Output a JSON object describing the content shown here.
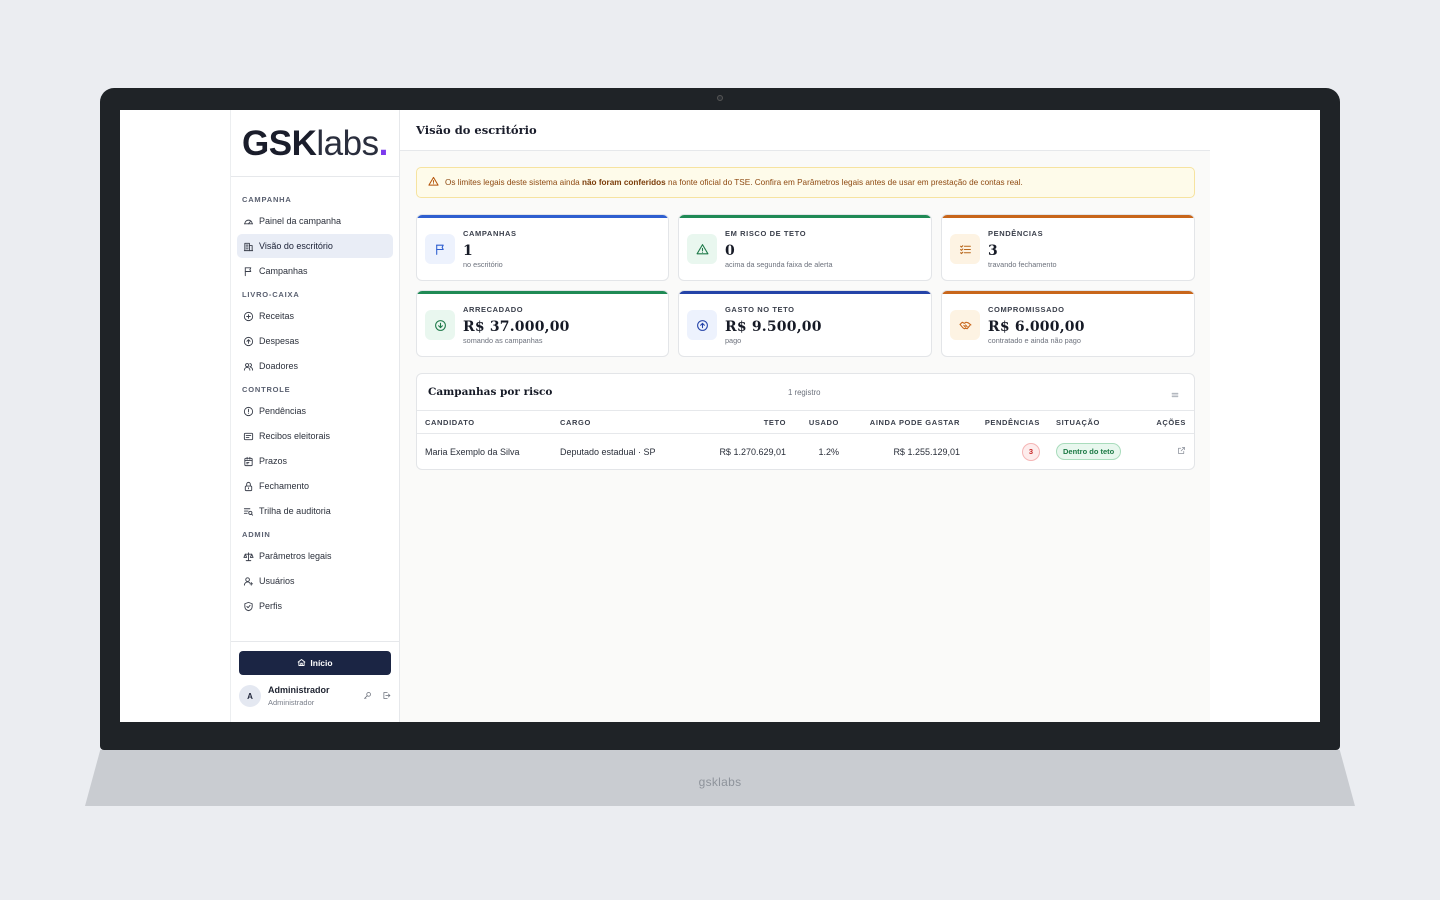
{
  "brand": {
    "part1": "GSK",
    "part2": "labs",
    "dot": ".",
    "device_label": "gsklabs"
  },
  "sidebar": {
    "sections": [
      {
        "title": "CAMPANHA",
        "items": [
          {
            "label": "Painel da campanha",
            "icon": "gauge-icon"
          },
          {
            "label": "Visão do escritório",
            "icon": "building-icon",
            "active": true
          },
          {
            "label": "Campanhas",
            "icon": "flag-icon"
          }
        ]
      },
      {
        "title": "LIVRO-CAIXA",
        "items": [
          {
            "label": "Receitas",
            "icon": "circle-plus-icon"
          },
          {
            "label": "Despesas",
            "icon": "circle-arrow-up-icon"
          },
          {
            "label": "Doadores",
            "icon": "users-icon"
          }
        ]
      },
      {
        "title": "CONTROLE",
        "items": [
          {
            "label": "Pendências",
            "icon": "alert-circle-icon"
          },
          {
            "label": "Recibos eleitorais",
            "icon": "receipt-icon"
          },
          {
            "label": "Prazos",
            "icon": "calendar-icon"
          },
          {
            "label": "Fechamento",
            "icon": "lock-icon"
          },
          {
            "label": "Trilha de auditoria",
            "icon": "list-search-icon"
          }
        ]
      },
      {
        "title": "ADMIN",
        "items": [
          {
            "label": "Parâmetros legais",
            "icon": "scale-icon"
          },
          {
            "label": "Usuários",
            "icon": "user-plus-icon"
          },
          {
            "label": "Perfis",
            "icon": "shield-check-icon"
          }
        ]
      }
    ],
    "home_button": "Início",
    "user": {
      "initial": "A",
      "name": "Administrador",
      "role": "Administrador"
    }
  },
  "header": {
    "title": "Visão do escritório"
  },
  "alert": {
    "before": "Os limites legais deste sistema ainda ",
    "bold": "não foram conferidos",
    "after": " na fonte oficial do TSE. Confira em Parâmetros legais antes de usar em prestação de contas real."
  },
  "stats": [
    {
      "label": "CAMPANHAS",
      "value": "1",
      "sub": "no escritório",
      "accent": "#2f5fd0",
      "icon": "flag-icon",
      "icon_bg": "#edf2fd",
      "icon_color": "#2f5fd0"
    },
    {
      "label": "EM RISCO DE TETO",
      "value": "0",
      "sub": "acima da segunda faixa de alerta",
      "accent": "#1f8a55",
      "icon": "warning-triangle-icon",
      "icon_bg": "#e9f7ef",
      "icon_color": "#1f7a4a"
    },
    {
      "label": "PENDÊNCIAS",
      "value": "3",
      "sub": "travando fechamento",
      "accent": "#c8661b",
      "icon": "list-check-icon",
      "icon_bg": "#fdf3e3",
      "icon_color": "#b8661b"
    },
    {
      "label": "ARRECADADO",
      "value": "R$ 37.000,00",
      "sub": "somando as campanhas",
      "accent": "#1f8a55",
      "icon": "arrow-down-circle-icon",
      "icon_bg": "#e9f7ef",
      "icon_color": "#1f7a4a"
    },
    {
      "label": "GASTO NO TETO",
      "value": "R$ 9.500,00",
      "sub": "pago",
      "accent": "#2443a8",
      "icon": "arrow-up-circle-icon",
      "icon_bg": "#edf2fd",
      "icon_color": "#2443a8"
    },
    {
      "label": "COMPROMISSADO",
      "value": "R$ 6.000,00",
      "sub": "contratado e ainda não pago",
      "accent": "#c8661b",
      "icon": "handshake-icon",
      "icon_bg": "#fdf3e3",
      "icon_color": "#c8661b"
    }
  ],
  "table": {
    "title": "Campanhas por risco",
    "count": "1 registro",
    "columns": {
      "candidato": "CANDIDATO",
      "cargo": "CARGO",
      "teto": "TETO",
      "usado": "USADO",
      "pode": "AINDA PODE GASTAR",
      "pendencias": "PENDÊNCIAS",
      "situacao": "SITUAÇÃO",
      "acoes": "AÇÕES"
    },
    "rows": [
      {
        "candidato": "Maria Exemplo da Silva",
        "cargo": "Deputado estadual · SP",
        "teto": "R$ 1.270.629,01",
        "usado": "1.2%",
        "pode": "R$ 1.255.129,01",
        "pendencias": "3",
        "situacao": "Dentro do teto"
      }
    ]
  }
}
